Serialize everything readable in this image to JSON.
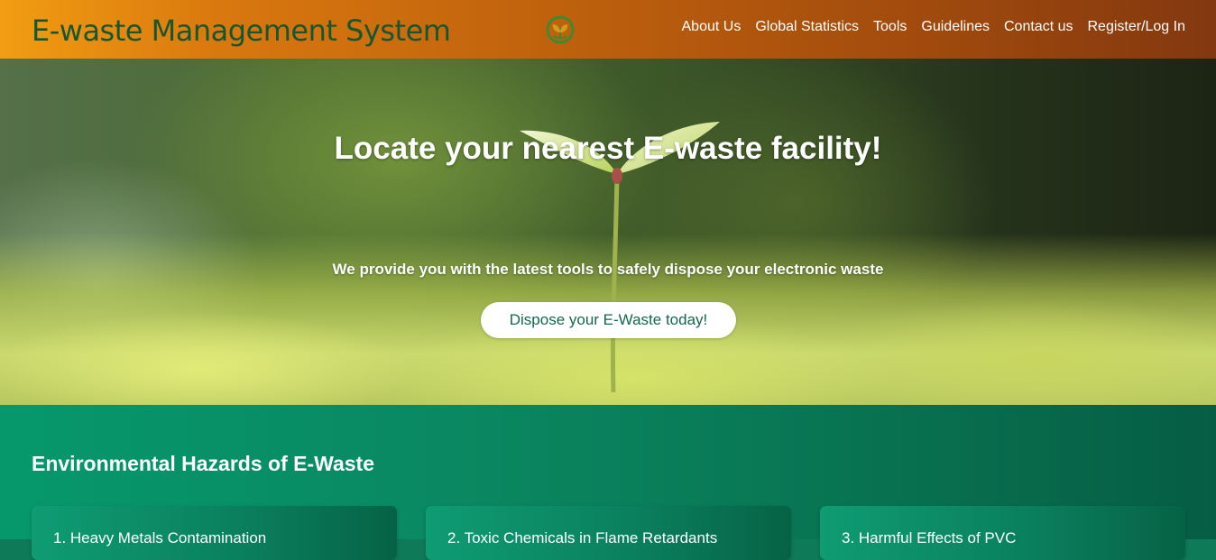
{
  "header": {
    "brand": "E-waste Management System",
    "logo_icon": "leaf-logo-icon",
    "nav": [
      {
        "label": "About Us"
      },
      {
        "label": "Global Statistics"
      },
      {
        "label": "Tools"
      },
      {
        "label": "Guidelines"
      },
      {
        "label": "Contact us"
      },
      {
        "label": "Register/Log In"
      }
    ],
    "colors": {
      "gradient_start": "#f29d12",
      "gradient_end": "#83380f",
      "brand_text": "#17562f"
    }
  },
  "hero": {
    "title": "Locate your nearest E-waste facility!",
    "subtitle": "We provide you with the latest tools to safely dispose your electronic waste",
    "cta_label": "Dispose your E-Waste today!"
  },
  "hazards": {
    "title": "Environmental Hazards of E-Waste",
    "cards": [
      {
        "title": "1. Heavy Metals Contamination"
      },
      {
        "title": "2. Toxic Chemicals in Flame Retardants"
      },
      {
        "title": "3. Harmful Effects of PVC"
      }
    ],
    "colors": {
      "section_bg": "#0a8760",
      "card_bg": "#0f9c73"
    }
  }
}
